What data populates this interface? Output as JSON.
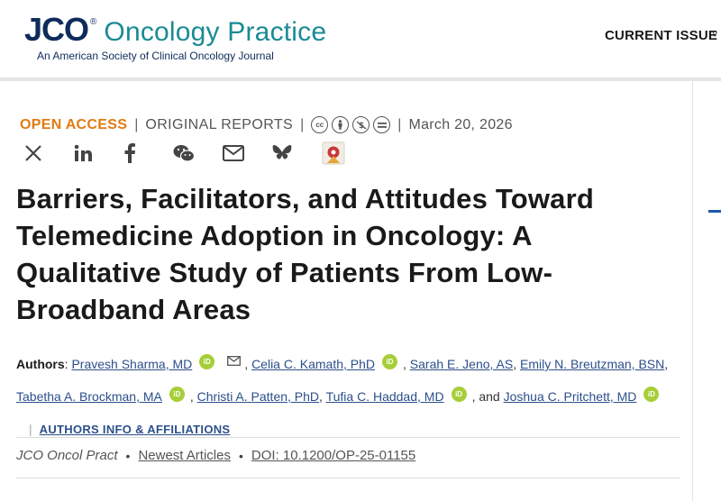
{
  "header": {
    "logo_jco": "JCO",
    "logo_reg": "®",
    "logo_op": "Oncology Practice",
    "logo_sub": "An American Society of Clinical Oncology Journal",
    "nav_current": "CURRENT ISSUE",
    "nav_caret": "˅"
  },
  "meta": {
    "open_access": "OPEN ACCESS",
    "sep": "|",
    "article_type": "ORIGINAL REPORTS",
    "license_icons": [
      "cc-icon",
      "by-icon",
      "nc-icon",
      "nd-icon"
    ],
    "date": "March 20, 2026"
  },
  "share": [
    "x-icon",
    "linkedin-icon",
    "facebook-icon",
    "wechat-icon",
    "email-icon",
    "bluesky-icon",
    "mendeley-icon"
  ],
  "title": "Barriers, Facilitators, and Attitudes Toward Telemedicine Adoption in Oncology: A Qualitative Study of Patients From Low-Broadband Areas",
  "authors": {
    "label": "Authors",
    "list": [
      "Pravesh Sharma, MD",
      "Celia C. Kamath, PhD",
      "Sarah E. Jeno, AS",
      "Emily N. Breutzman, BSN",
      "Tabetha A. Brockman, MA",
      "Christi A. Patten, PhD",
      "Tufia C. Haddad, MD",
      "Joshua C. Pritchett, MD"
    ],
    "orcid": "iD",
    "and": "and",
    "affiliations_link": "AUTHORS INFO & AFFILIATIONS"
  },
  "citation": {
    "journal": "JCO Oncol Pract",
    "section": "Newest Articles",
    "doi": "DOI: 10.1200/OP-25-01155",
    "bullet": "•"
  },
  "colors": {
    "brand_navy": "#0d2c5b",
    "brand_teal": "#1a8b94",
    "open_access": "#e07b12",
    "link": "#2c4f8a",
    "orcid": "#a6ce39"
  }
}
